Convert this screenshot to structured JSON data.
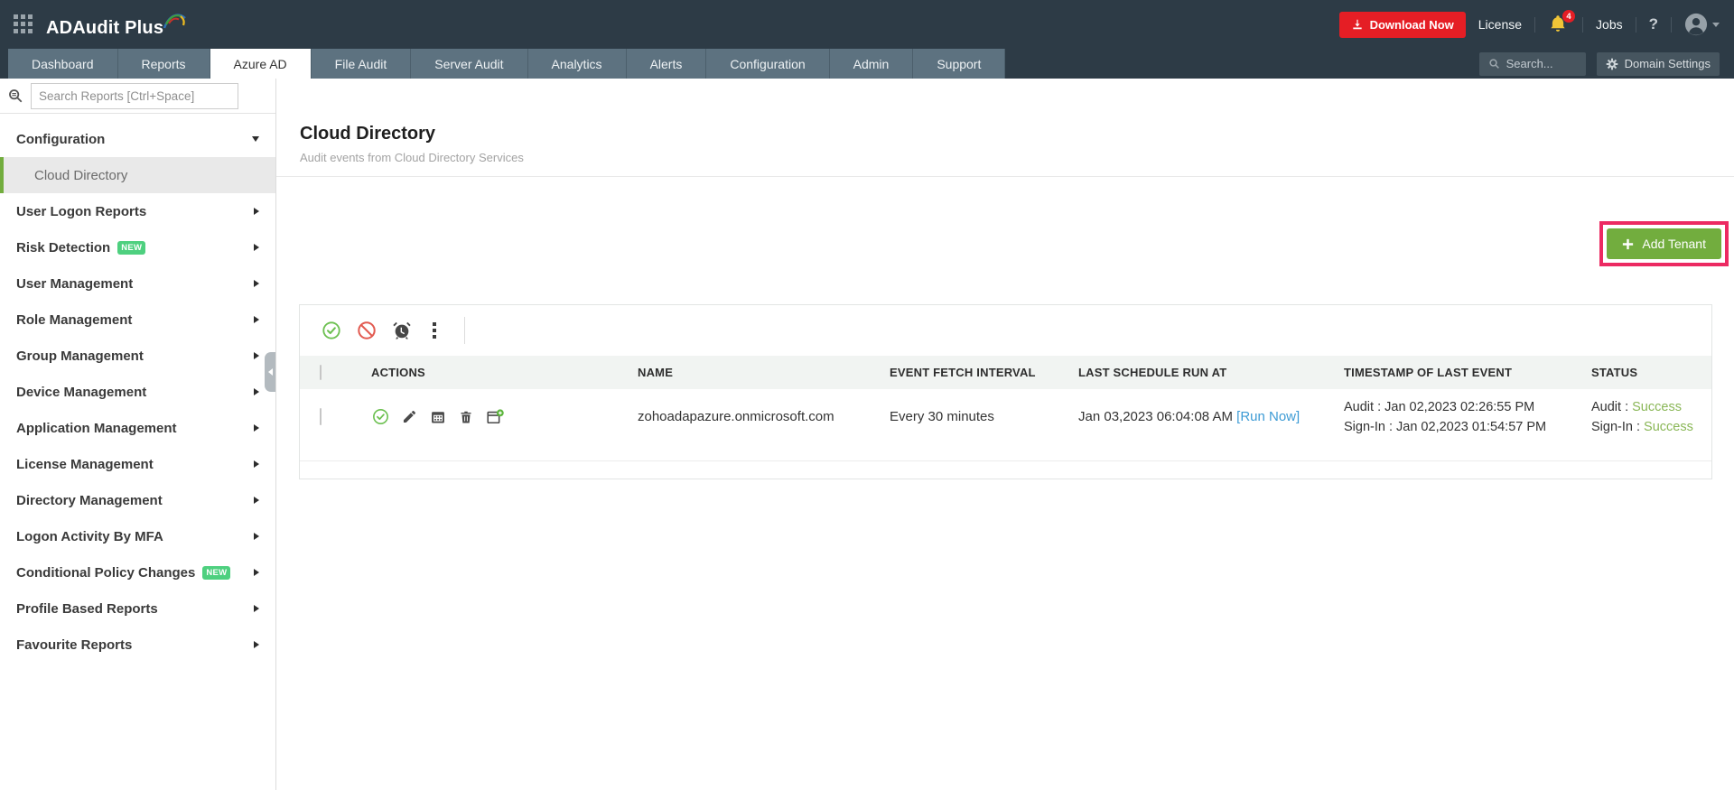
{
  "colors": {
    "c-topbar": "#2d3b46",
    "c-tabbar": "#5d7280",
    "c-accent-green": "#72ad3e",
    "c-badge-green": "#4ed07f",
    "c-success": "#8ab757",
    "c-pink": "#ec2a62",
    "c-red": "#e51e25",
    "c-blue": "#3d9bd5",
    "c-yellow": "#f0c537"
  },
  "icons": [
    "app-grid-icon",
    "logo-swoosh-icon",
    "download-icon",
    "bell-icon",
    "help-icon",
    "user-avatar-icon",
    "search-icon",
    "gear-icon",
    "report-search-icon",
    "enable-icon",
    "disable-icon",
    "alarm-icon",
    "more-icon",
    "edit-icon",
    "calendar-icon",
    "delete-icon",
    "add-page-icon",
    "plus-icon",
    "chevron-right-icon",
    "chevron-down-icon",
    "collapse-arrow-icon"
  ],
  "topbar": {
    "app_name": "ADAudit Plus",
    "download_label": "Download Now",
    "license_label": "License",
    "notification_count": "4",
    "jobs_label": "Jobs",
    "help_label": "?"
  },
  "tabs": [
    {
      "label": "Dashboard"
    },
    {
      "label": "Reports"
    },
    {
      "label": "Azure AD"
    },
    {
      "label": "File Audit"
    },
    {
      "label": "Server Audit"
    },
    {
      "label": "Analytics"
    },
    {
      "label": "Alerts"
    },
    {
      "label": "Configuration"
    },
    {
      "label": "Admin"
    },
    {
      "label": "Support"
    }
  ],
  "tabbar": {
    "search_placeholder": "Search...",
    "domain_settings_label": "Domain Settings"
  },
  "sidebar": {
    "search_placeholder": "Search Reports [Ctrl+Space]",
    "items": [
      {
        "label": "Configuration"
      },
      {
        "label": "Cloud Directory"
      },
      {
        "label": "User Logon Reports"
      },
      {
        "label": "Risk Detection",
        "badge": "NEW"
      },
      {
        "label": "User Management"
      },
      {
        "label": "Role Management"
      },
      {
        "label": "Group Management"
      },
      {
        "label": "Device Management"
      },
      {
        "label": "Application Management"
      },
      {
        "label": "License Management"
      },
      {
        "label": "Directory Management"
      },
      {
        "label": "Logon Activity By MFA"
      },
      {
        "label": "Conditional Policy Changes",
        "badge": "NEW"
      },
      {
        "label": "Profile Based Reports"
      },
      {
        "label": "Favourite Reports"
      }
    ]
  },
  "page": {
    "title": "Cloud Directory",
    "subtitle": "Audit events from Cloud Directory Services",
    "add_tenant_label": "Add Tenant"
  },
  "table": {
    "headers": {
      "actions": "ACTIONS",
      "name": "NAME",
      "interval": "EVENT FETCH INTERVAL",
      "last_run": "LAST SCHEDULE RUN AT",
      "timestamp": "TIMESTAMP OF LAST EVENT",
      "status": "STATUS"
    },
    "row": {
      "name": "zohoadapazure.onmicrosoft.com",
      "interval": "Every 30 minutes",
      "last_run": "Jan 03,2023 06:04:08 AM",
      "run_now": "[Run Now]",
      "timestamp_audit": "Audit : Jan 02,2023 02:26:55 PM",
      "timestamp_signin": "Sign-In : Jan 02,2023 01:54:57 PM",
      "status_audit_label": "Audit :",
      "status_audit_value": "Success",
      "status_signin_label": "Sign-In :",
      "status_signin_value": "Success"
    }
  }
}
